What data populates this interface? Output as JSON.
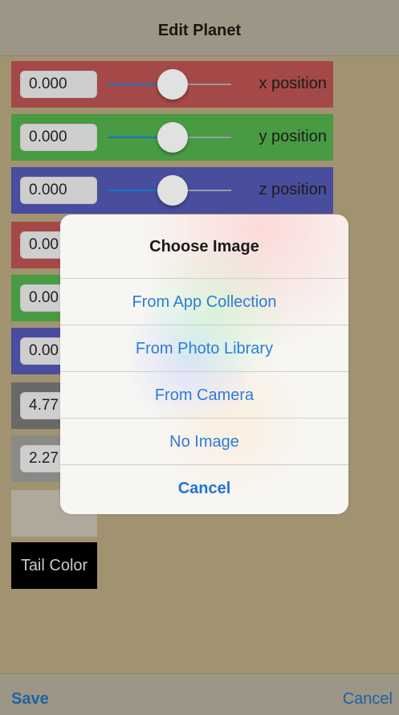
{
  "navbar": {
    "title": "Edit Planet"
  },
  "rows": [
    {
      "value": "0.000",
      "label": "x position"
    },
    {
      "value": "0.000",
      "label": "y position"
    },
    {
      "value": "0.000",
      "label": "z position"
    },
    {
      "value": "0.00"
    },
    {
      "value": "0.00"
    },
    {
      "value": "0.00"
    },
    {
      "value": "4.77"
    },
    {
      "value": "2.27"
    }
  ],
  "tail_color_label": "Tail Color",
  "toolbar": {
    "save_label": "Save",
    "cancel_label": "Cancel"
  },
  "action_sheet": {
    "title": "Choose Image",
    "options": [
      "From App Collection",
      "From Photo Library",
      "From Camera",
      "No Image"
    ],
    "cancel": "Cancel"
  },
  "colors": {
    "background": "#a59673",
    "red_row": "#a84b49",
    "green_row": "#4a9f45",
    "blue_row": "#4b4fa1",
    "accent": "#2d7cd6"
  }
}
